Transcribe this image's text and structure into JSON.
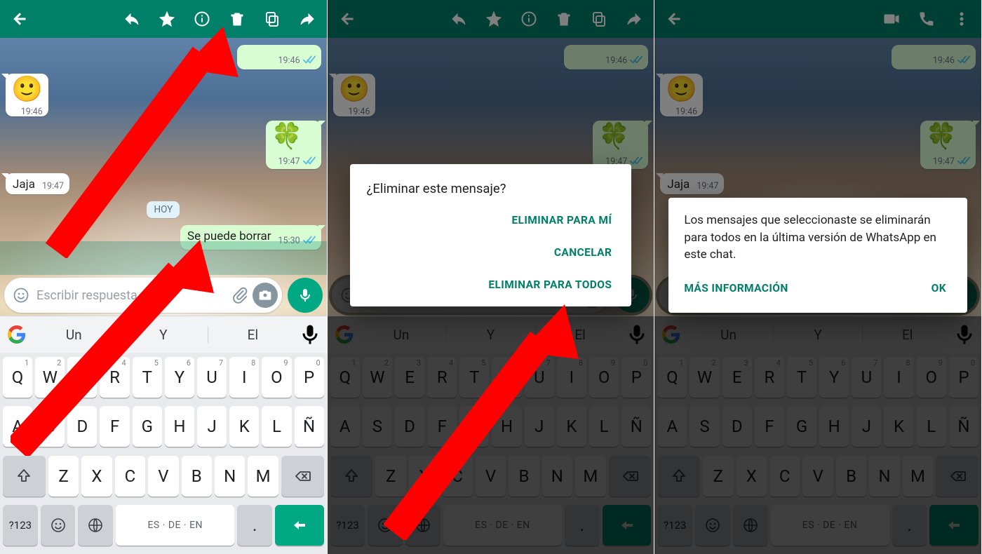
{
  "colors": {
    "brand": "#008069",
    "accent": "#00a884",
    "tick_read": "#53bdeb"
  },
  "chat": {
    "messages": {
      "m1_time": "19:46",
      "m2_emoji": "🙂",
      "m2_time": "19:46",
      "m3_emoji": "🍀",
      "m3_time": "19:47",
      "m4_text": "Jaja",
      "m4_time": "19:47",
      "date_chip": "HOY",
      "m5_text": "Se puede borrar",
      "m5_time": "15:30"
    },
    "input_placeholder": "Escribir respuesta..."
  },
  "keyboard": {
    "suggestions": {
      "s1": "Un",
      "s2": "Y",
      "s3": "El"
    },
    "row1": [
      {
        "k": "Q",
        "h": "1"
      },
      {
        "k": "W",
        "h": "2"
      },
      {
        "k": "E",
        "h": "3"
      },
      {
        "k": "R",
        "h": "4"
      },
      {
        "k": "T",
        "h": "5"
      },
      {
        "k": "Y",
        "h": "6"
      },
      {
        "k": "U",
        "h": "7"
      },
      {
        "k": "I",
        "h": "8"
      },
      {
        "k": "O",
        "h": "9"
      },
      {
        "k": "P",
        "h": "0"
      }
    ],
    "row2": [
      "A",
      "S",
      "D",
      "F",
      "G",
      "H",
      "J",
      "K",
      "L",
      "Ñ"
    ],
    "row3": [
      "Z",
      "X",
      "C",
      "V",
      "B",
      "N",
      "M"
    ],
    "symkey": "?123",
    "space_label": "ES · DE · EN"
  },
  "dialog_delete": {
    "title": "¿Eliminar este mensaje?",
    "opt_me": "ELIMINAR PARA MÍ",
    "opt_cancel": "CANCELAR",
    "opt_all": "ELIMINAR PARA TODOS"
  },
  "dialog_info": {
    "body": "Los mensajes que seleccionaste se eliminarán para todos en la última versión de WhatsApp en este chat.",
    "more": "MÁS INFORMACIÓN",
    "ok": "OK"
  }
}
